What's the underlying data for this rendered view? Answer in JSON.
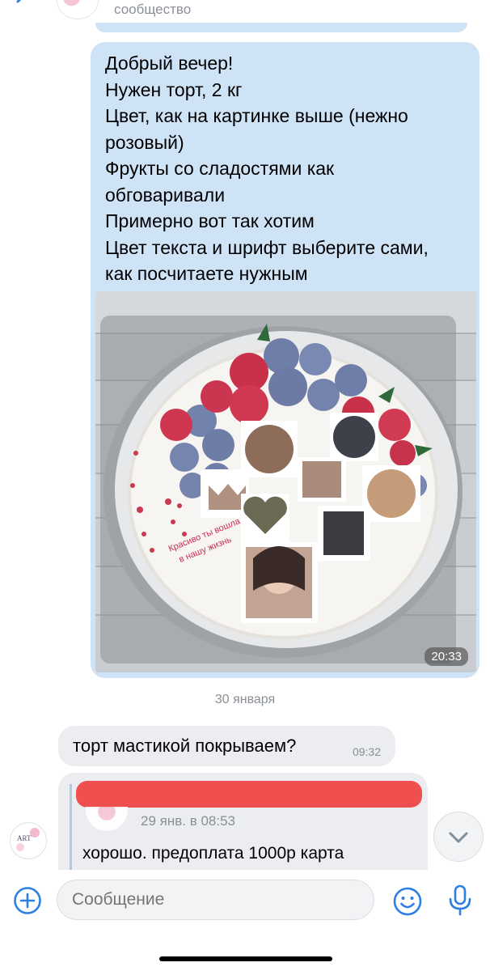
{
  "header": {
    "subtitle": "сообщество",
    "back_icon": "chevron-left-icon",
    "avatar": "community-avatar"
  },
  "colors": {
    "accent": "#2c7fe3",
    "outgoing_bubble": "#cfe3f7",
    "incoming_bubble": "#ebedf0",
    "muted_text": "#8a8f96",
    "redaction": "#ef4f4f"
  },
  "outgoing_message": {
    "lines": [
      "Добрый вечер!",
      "Нужен торт, 2 кг",
      "Цвет, как на картинке выше (нежно",
      "розовый)",
      "Фрукты со сладостями как",
      "обговаривали",
      "Примерно вот так хотим",
      "Цвет текста и шрифт выберите сами,",
      "как посчитаете нужным"
    ],
    "photo": {
      "caption_on_cake": "Красиво ты вошла в нашу жизнь",
      "time": "20:33"
    }
  },
  "date_separator": "30 января",
  "incoming_messages": [
    {
      "text": "торт мастикой покрываем?",
      "time": "09:32"
    },
    {
      "quote_date": "29 янв. в 08:53",
      "text": "хорошо. предоплата 1000р карта"
    }
  ],
  "input": {
    "placeholder": "Сообщение",
    "attach_icon": "plus-circle-icon",
    "emoji_icon": "smile-icon",
    "mic_icon": "microphone-icon"
  },
  "scroll_icon": "chevron-down-icon"
}
